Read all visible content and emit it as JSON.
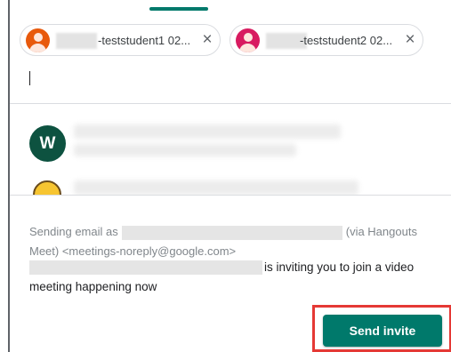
{
  "recipients": [
    {
      "label": "-teststudent1 02...",
      "remove_icon": "close-icon",
      "avatar_color": "#e8590c"
    },
    {
      "label": "-teststudent2 02...",
      "remove_icon": "close-icon",
      "avatar_color": "#d81b60"
    }
  ],
  "close_glyph": "×",
  "suggestions": [
    {
      "avatar_letter": "W",
      "avatar_color": "#0d5240"
    },
    {
      "avatar_icon": "emoji-avatar-icon"
    }
  ],
  "email_info": {
    "prefix": "Sending email as",
    "suffix": "(via Hangouts Meet) <meetings-noreply@google.com>"
  },
  "message": {
    "text": "is inviting you to join a video meeting happening now"
  },
  "send_button": {
    "label": "Send invite",
    "color": "#00796b"
  },
  "highlight_color": "#e53935"
}
